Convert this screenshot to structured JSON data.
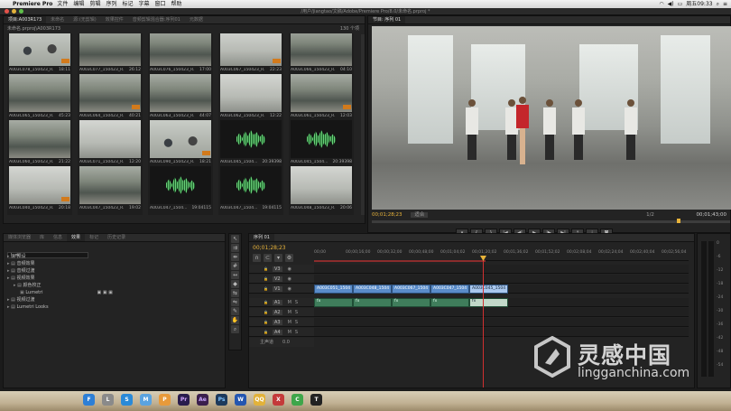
{
  "menubar": {
    "app": "Premiere Pro",
    "items": [
      "文件",
      "编辑",
      "剪辑",
      "序列",
      "标记",
      "字幕",
      "窗口",
      "帮助"
    ],
    "clock": "周五09:33"
  },
  "window_title": "/用户/jiangtao/文稿/Adobe/Premiere Pro/8.0/未命名.prproj *",
  "project": {
    "tabs": [
      "项目:A003R1?3",
      "未命名",
      "源:(无剪辑)",
      "效果控件",
      "音频剪辑混合器:序列01",
      "元数据"
    ],
    "path": "未命名.prproj\\A003R173",
    "item_count": "130 个项",
    "clips": [
      {
        "name": "A003C078_150423_R...",
        "dur": "18:11",
        "style": "people"
      },
      {
        "name": "A003C077_150423_R...",
        "dur": "26:12",
        "style": "office"
      },
      {
        "name": "A003C076_150423_R...",
        "dur": "17:00",
        "style": "office"
      },
      {
        "name": "A003C067_150423_R...",
        "dur": "22:23",
        "style": "white"
      },
      {
        "name": "A003C066_150423_R...",
        "dur": "04:10",
        "style": "office"
      },
      {
        "name": "A003C065_150423_R...",
        "dur": "45:23",
        "style": "office"
      },
      {
        "name": "A003C064_150423_R...",
        "dur": "40:21",
        "style": "office"
      },
      {
        "name": "A003C063_150423_R...",
        "dur": "44:07",
        "style": "office"
      },
      {
        "name": "A003C062_150423_R...",
        "dur": "12:22",
        "style": "white"
      },
      {
        "name": "A003C061_150423_R...",
        "dur": "12:03",
        "style": "office"
      },
      {
        "name": "A003C060_150423_R...",
        "dur": "21:22",
        "style": "office"
      },
      {
        "name": "A003C071_150423_R...",
        "dur": "12:20",
        "style": "white"
      },
      {
        "name": "A003C090_150423_R...",
        "dur": "18:21",
        "style": "people"
      },
      {
        "name": "A003C045_1504...",
        "dur": "20:39398",
        "style": "audio"
      },
      {
        "name": "A003C045_1504...",
        "dur": "20:39398",
        "style": "audio"
      },
      {
        "name": "A003C040_150423_R...",
        "dur": "20:18",
        "style": "white"
      },
      {
        "name": "A003C047_150423_R...",
        "dur": "19:02",
        "style": "office"
      },
      {
        "name": "A003C047_1504...",
        "dur": "19:04115",
        "style": "audio"
      },
      {
        "name": "A003C047_1504...",
        "dur": "19:04115",
        "style": "audio"
      },
      {
        "name": "A003C048_150423_R...",
        "dur": "20:06",
        "style": "white"
      }
    ]
  },
  "program": {
    "tab": "节目: 序列 01",
    "timecode": "00;01;28;23",
    "fit": "适合",
    "fraction": "1/2",
    "duration": "00;01;43;00",
    "buttons": [
      "add-marker",
      "mark-in",
      "mark-out",
      "go-to-in",
      "step-back",
      "play",
      "step-forward",
      "go-to-out",
      "lift",
      "extract",
      "export-frame"
    ]
  },
  "effects": {
    "tabs": [
      "媒体浏览器",
      "库",
      "信息",
      "效果",
      "标记",
      "历史记录"
    ],
    "search": "lum",
    "items": [
      {
        "label": "预设",
        "indent": 0
      },
      {
        "label": "音频效果",
        "indent": 0
      },
      {
        "label": "音频过渡",
        "indent": 0
      },
      {
        "label": "视频效果",
        "indent": 0
      },
      {
        "label": "颜色校正",
        "indent": 1
      },
      {
        "label": "Lumetri",
        "indent": 2
      },
      {
        "label": "视频过渡",
        "indent": 0
      },
      {
        "label": "Lumetri Looks",
        "indent": 0
      }
    ]
  },
  "timeline": {
    "tab": "序列 01",
    "timecode": "00;01;28;23",
    "ruler": [
      "00;00",
      "00;00;16;00",
      "00;00;32;00",
      "00;00;48;00",
      "00;01;04;02",
      "00;01;20;02",
      "00;01;36;02",
      "00;01;52;02",
      "00;02;08;04",
      "00;02;24;04",
      "00;02;40;04",
      "00;02;56;04"
    ],
    "tracks": [
      "V3",
      "V2",
      "V1",
      "A1",
      "A2",
      "A3",
      "A4"
    ],
    "master": "主声道",
    "master_value": "0.0",
    "video_clips": [
      "A003C051_1504",
      "A003C048_1504",
      "A003C067_1504",
      "A003C047_1504",
      "A003C045_1504"
    ],
    "audio_mark": "fx"
  },
  "meter_scale": [
    "0",
    "-6",
    "-12",
    "-18",
    "-24",
    "-30",
    "-36",
    "-42",
    "-48",
    "-54"
  ],
  "watermark": {
    "brand": "灵感中国",
    "url": "lingganchina.com"
  },
  "dock_apps": [
    "Finder",
    "Launchpad",
    "Safari",
    "Mail",
    "Photos",
    "Pr",
    "Ae",
    "Ps",
    "W",
    "QQ",
    "X",
    "Chrome",
    "Terminal"
  ]
}
